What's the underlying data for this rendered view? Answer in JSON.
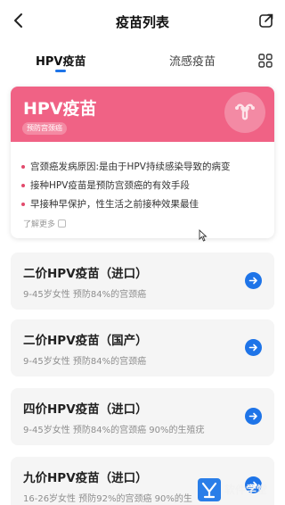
{
  "header": {
    "title": "疫苗列表",
    "back_icon": "back-arrow-icon",
    "share_icon": "share-icon"
  },
  "tabs": [
    {
      "label": "HPV疫苗",
      "active": true
    },
    {
      "label": "流感疫苗",
      "active": false
    }
  ],
  "hero": {
    "title": "HPV疫苗",
    "tag": "预防宫颈癌",
    "color": "#f06285",
    "items": [
      "宫颈癌发病原因:是由于HPV持续感染导致的病变",
      "接种HPV疫苗是预防宫颈癌的有效手段",
      "早接种早保护，性生活之前接种效果最佳"
    ],
    "more_label": "了解更多"
  },
  "vaccines": [
    {
      "title": "二价HPV疫苗（进口）",
      "subtitle": "9-45岁女性 预防84%的宫颈癌"
    },
    {
      "title": "二价HPV疫苗（国产）",
      "subtitle": "9-45岁女性 预防84%的宫颈癌"
    },
    {
      "title": "四价HPV疫苗（进口）",
      "subtitle": "9-45岁女性 预防84%的宫颈癌 90%的生殖疣"
    },
    {
      "title": "九价HPV疫苗（进口）",
      "subtitle": "16-26岁女性 预防92%的宫颈癌 90%的生"
    }
  ],
  "accent_color": "#1e74e8",
  "watermark": "软件学堂"
}
